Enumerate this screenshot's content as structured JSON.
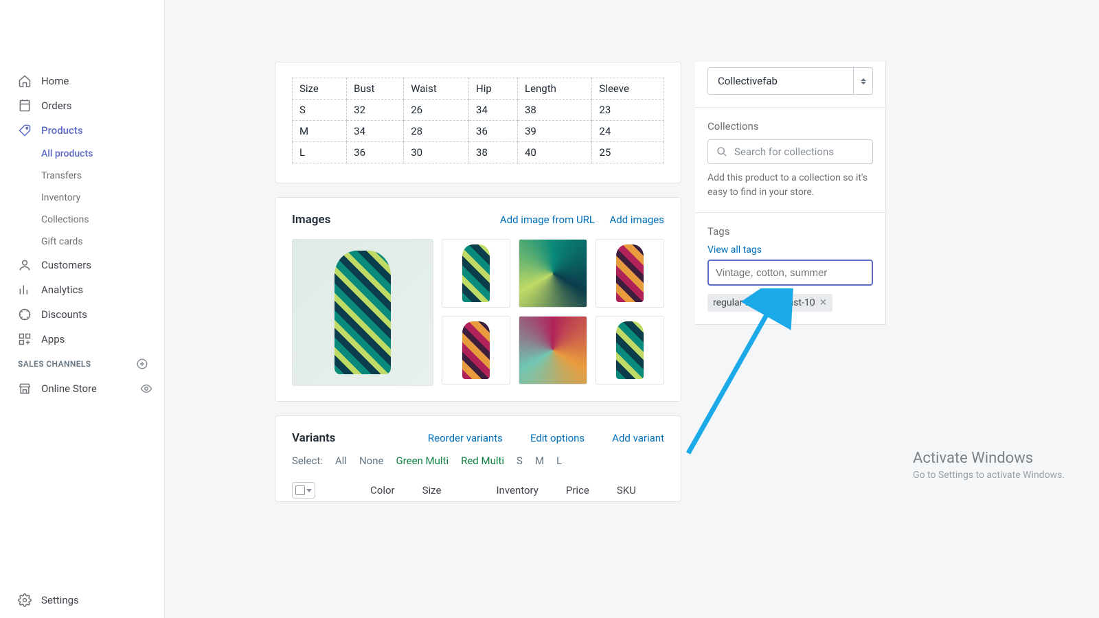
{
  "sidebar": {
    "home": "Home",
    "orders": "Orders",
    "products": "Products",
    "all_products": "All products",
    "transfers": "Transfers",
    "inventory": "Inventory",
    "collections": "Collections",
    "gift_cards": "Gift cards",
    "customers": "Customers",
    "analytics": "Analytics",
    "discounts": "Discounts",
    "apps": "Apps",
    "sales_channels": "SALES CHANNELS",
    "online_store": "Online Store",
    "settings": "Settings"
  },
  "size_table": {
    "headers": [
      "Size",
      "Bust",
      "Waist",
      "Hip",
      "Length",
      "Sleeve"
    ],
    "rows": [
      [
        "S",
        "32",
        "26",
        "34",
        "38",
        "23"
      ],
      [
        "M",
        "34",
        "28",
        "36",
        "39",
        "24"
      ],
      [
        "L",
        "36",
        "30",
        "38",
        "40",
        "25"
      ]
    ]
  },
  "images": {
    "title": "Images",
    "add_url": "Add image from URL",
    "add_images": "Add images"
  },
  "variants": {
    "title": "Variants",
    "reorder": "Reorder variants",
    "edit_options": "Edit options",
    "add_variant": "Add variant",
    "select_label": "Select:",
    "select_all": "All",
    "select_none": "None",
    "opt_green": "Green Multi",
    "opt_red": "Red Multi",
    "opt_s": "S",
    "opt_m": "M",
    "opt_l": "L",
    "col_color": "Color",
    "col_size": "Size",
    "col_inventory": "Inventory",
    "col_price": "Price",
    "col_sku": "SKU"
  },
  "vendor": {
    "value": "Collectivefab"
  },
  "collections": {
    "title": "Collections",
    "placeholder": "Search for collections",
    "helper": "Add this product to a collection so it's easy to find in your store."
  },
  "tags": {
    "title": "Tags",
    "view_all": "View all tags",
    "placeholder": "Vintage, cotton, summer",
    "chips": [
      "regular-20",
      "fast-10"
    ]
  },
  "activate": {
    "title": "Activate Windows",
    "sub": "Go to Settings to activate Windows."
  }
}
